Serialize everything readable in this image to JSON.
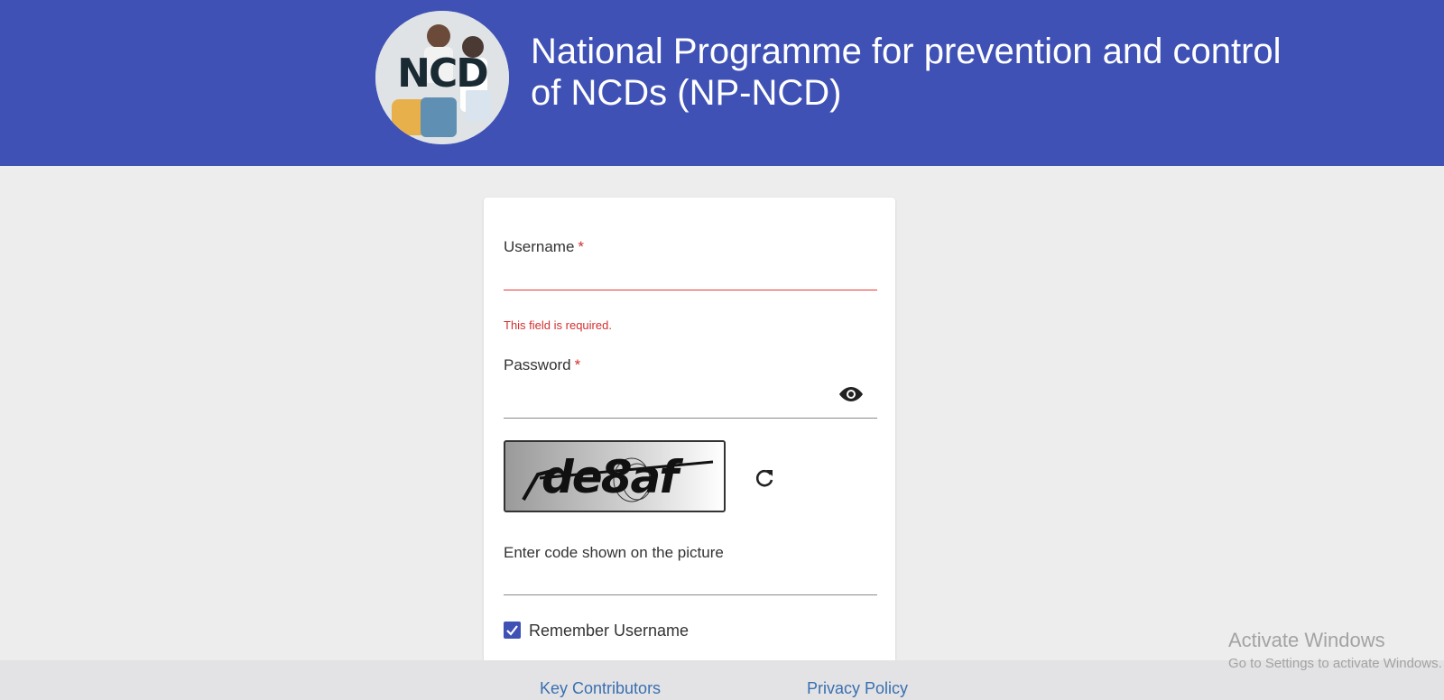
{
  "header": {
    "logo_text": "NCD",
    "title_line1": "National Programme for prevention and control",
    "title_line2": "of NCDs (NP-NCD)",
    "background_color": "#3f51b5"
  },
  "login_form": {
    "username": {
      "label": "Username",
      "required_mark": "*",
      "value": "",
      "error": "This field is required."
    },
    "password": {
      "label": "Password",
      "required_mark": "*",
      "value": "",
      "toggle_icon": "eye-icon"
    },
    "captcha": {
      "image_code": "de8af",
      "refresh_icon": "refresh-icon",
      "input_label": "Enter code shown on the picture",
      "value": ""
    },
    "remember": {
      "label": "Remember Username",
      "checked": true
    }
  },
  "footer": {
    "links": [
      "Key Contributors",
      "Privacy Policy"
    ]
  },
  "watermark": {
    "title": "Activate Windows",
    "subtitle": "Go to Settings to activate Windows."
  },
  "colors": {
    "primary": "#3f51b5",
    "error": "#d32f2f",
    "link": "#3a6fb0",
    "page_background": "#ededed"
  }
}
